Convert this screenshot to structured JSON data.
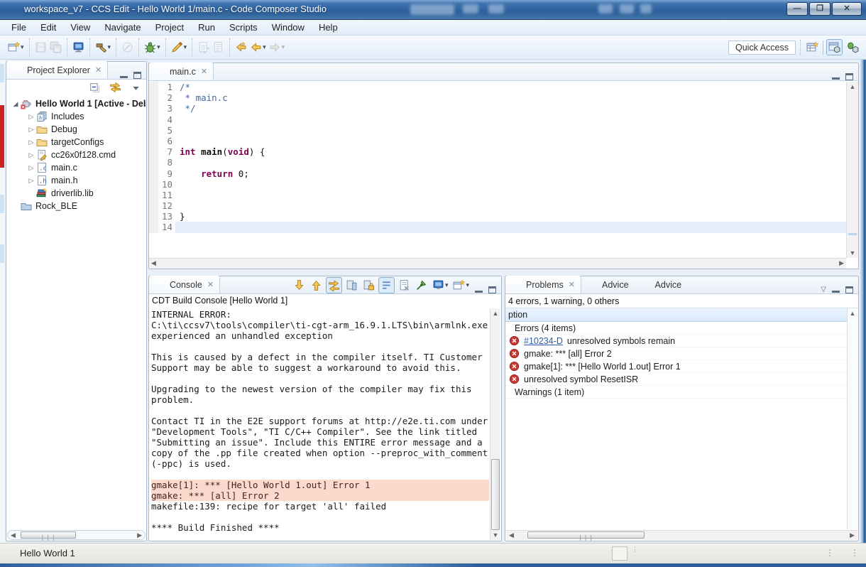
{
  "titlebar": {
    "title": "workspace_v7 - CCS Edit - Hello World 1/main.c - Code Composer Studio"
  },
  "menubar": {
    "items": [
      "File",
      "Edit",
      "View",
      "Navigate",
      "Project",
      "Run",
      "Scripts",
      "Window",
      "Help"
    ]
  },
  "toolbar": {
    "quick_access": "Quick Access",
    "groups": [
      {
        "items": [
          {
            "name": "new-wizard",
            "dropdown": true
          }
        ]
      },
      {
        "items": [
          {
            "name": "save",
            "disabled": true
          },
          {
            "name": "save-all",
            "disabled": true
          }
        ]
      },
      {
        "items": [
          {
            "name": "target-console"
          }
        ]
      },
      {
        "items": [
          {
            "name": "build",
            "dropdown": true
          }
        ]
      },
      {
        "items": [
          {
            "name": "launch",
            "disabled": true
          }
        ]
      },
      {
        "items": [
          {
            "name": "debug",
            "dropdown": true
          }
        ]
      },
      {
        "items": [
          {
            "name": "flash",
            "dropdown": true
          }
        ]
      },
      {
        "items": [
          {
            "name": "sync",
            "disabled": true
          },
          {
            "name": "open-doc",
            "disabled": true
          }
        ]
      },
      {
        "items": [
          {
            "name": "last-edit"
          },
          {
            "name": "back",
            "dropdown": true
          },
          {
            "name": "forward",
            "disabled": true,
            "dropdown": true
          }
        ]
      }
    ],
    "perspectives": [
      {
        "name": "open-perspective",
        "pressed": false
      },
      {
        "name": "ccs-edit-perspective",
        "pressed": true
      },
      {
        "name": "ccs-debug-perspective",
        "pressed": false
      }
    ]
  },
  "project_explorer": {
    "title": "Project Explorer",
    "toolbar": [
      {
        "name": "collapse-all"
      },
      {
        "name": "link-with-editor"
      },
      {
        "name": "view-menu"
      }
    ],
    "tree": [
      {
        "label": "Hello World 1  [Active - Deb",
        "icon": "ccs-project",
        "level": 0,
        "expander": "expanded",
        "bold": true
      },
      {
        "label": "Includes",
        "icon": "includes",
        "level": 1,
        "expander": "collapsed"
      },
      {
        "label": "Debug",
        "icon": "folder",
        "level": 1,
        "expander": "collapsed"
      },
      {
        "label": "targetConfigs",
        "icon": "folder",
        "level": 1,
        "expander": "collapsed"
      },
      {
        "label": "cc26x0f128.cmd",
        "icon": "cmd-file",
        "level": 1,
        "expander": "collapsed"
      },
      {
        "label": "main.c",
        "icon": "c-file",
        "level": 1,
        "expander": "collapsed"
      },
      {
        "label": "main.h",
        "icon": "h-file",
        "level": 1,
        "expander": "collapsed"
      },
      {
        "label": "driverlib.lib",
        "icon": "library",
        "level": 1,
        "expander": null
      },
      {
        "label": "Rock_BLE",
        "icon": "closed-project",
        "level": 0,
        "expander": null
      }
    ]
  },
  "editor": {
    "tab": "main.c",
    "lines": [
      {
        "n": "1",
        "hl": false,
        "parts": [
          {
            "t": "/*",
            "c": "comment"
          }
        ]
      },
      {
        "n": "2",
        "hl": false,
        "parts": [
          {
            "t": " * main.c",
            "c": "comment"
          }
        ]
      },
      {
        "n": "3",
        "hl": false,
        "parts": [
          {
            "t": " */",
            "c": "comment"
          }
        ]
      },
      {
        "n": "4",
        "hl": false,
        "parts": []
      },
      {
        "n": "5",
        "hl": false,
        "parts": []
      },
      {
        "n": "6",
        "hl": false,
        "parts": []
      },
      {
        "n": "7",
        "hl": false,
        "parts": [
          {
            "t": "int",
            "c": "kw"
          },
          {
            "t": " ",
            "c": "plain"
          },
          {
            "t": "main",
            "c": "fn"
          },
          {
            "t": "(",
            "c": "plain"
          },
          {
            "t": "void",
            "c": "kw"
          },
          {
            "t": ") {",
            "c": "plain"
          }
        ]
      },
      {
        "n": "8",
        "hl": false,
        "parts": []
      },
      {
        "n": "9",
        "hl": false,
        "parts": [
          {
            "t": "    ",
            "c": "plain"
          },
          {
            "t": "return",
            "c": "kw"
          },
          {
            "t": " 0;",
            "c": "plain"
          }
        ]
      },
      {
        "n": "10",
        "hl": false,
        "parts": []
      },
      {
        "n": "11",
        "hl": false,
        "parts": []
      },
      {
        "n": "12",
        "hl": false,
        "parts": []
      },
      {
        "n": "13",
        "hl": false,
        "parts": [
          {
            "t": "}",
            "c": "plain"
          }
        ]
      },
      {
        "n": "14",
        "hl": true,
        "parts": []
      }
    ]
  },
  "console": {
    "tab": "Console",
    "subtitle": "CDT Build Console [Hello World 1]",
    "toolbar": [
      {
        "name": "next-annotation"
      },
      {
        "name": "prev-annotation"
      },
      {
        "name": "link-annotations",
        "pressed": true
      },
      {
        "name": "show-console-output"
      },
      {
        "name": "scroll-lock"
      },
      {
        "name": "word-wrap",
        "pressed": true
      },
      {
        "name": "clear-console"
      },
      {
        "name": "pin-console"
      },
      {
        "name": "display-console",
        "dropdown": true
      },
      {
        "name": "open-console",
        "dropdown": true
      }
    ],
    "lines": [
      {
        "text": "INTERNAL ERROR: ",
        "hl": false
      },
      {
        "text": "C:\\ti\\ccsv7\\tools\\compiler\\ti-cgt-arm_16.9.1.LTS\\bin\\armlnk.exe",
        "hl": false
      },
      {
        "text": "experienced an unhandled exception",
        "hl": false
      },
      {
        "text": "",
        "hl": false
      },
      {
        "text": "This is caused by a defect in the compiler itself. TI Customer",
        "hl": false
      },
      {
        "text": "Support may be able to suggest a workaround to avoid this.",
        "hl": false
      },
      {
        "text": "",
        "hl": false
      },
      {
        "text": "Upgrading to the newest version of the compiler may fix this",
        "hl": false
      },
      {
        "text": "problem.",
        "hl": false
      },
      {
        "text": "",
        "hl": false
      },
      {
        "text": "Contact TI in the E2E support forums at http://e2e.ti.com under",
        "hl": false
      },
      {
        "text": "\"Development Tools\", \"TI C/C++ Compiler\". See the link titled",
        "hl": false
      },
      {
        "text": "\"Submitting an issue\". Include this ENTIRE error message and a",
        "hl": false
      },
      {
        "text": "copy of the .pp file created when option --preproc_with_comment",
        "hl": false
      },
      {
        "text": "(-ppc) is used.",
        "hl": false
      },
      {
        "text": "",
        "hl": false
      },
      {
        "text": "gmake[1]: *** [Hello World 1.out] Error 1",
        "hl": true
      },
      {
        "text": "gmake: *** [all] Error 2",
        "hl": true
      },
      {
        "text": "makefile:139: recipe for target 'all' failed",
        "hl": false
      },
      {
        "text": "",
        "hl": false
      },
      {
        "text": "**** Build Finished ****",
        "hl": false
      }
    ]
  },
  "problems": {
    "tabs": [
      {
        "label": "Problems",
        "icon": "problems"
      },
      {
        "label": "Advice",
        "icon": "bulb"
      },
      {
        "label": "Advice",
        "icon": "globe"
      }
    ],
    "summary": "4 errors, 1 warning, 0 others",
    "column_header": "ption",
    "rows": [
      {
        "kind": "group",
        "text": "Errors (4 items)"
      },
      {
        "kind": "error",
        "link": "#10234-D",
        "text": "unresolved symbols remain"
      },
      {
        "kind": "error",
        "text": "gmake: *** [all] Error 2"
      },
      {
        "kind": "error",
        "text": "gmake[1]: *** [Hello World 1.out] Error 1"
      },
      {
        "kind": "error",
        "text": "unresolved symbol ResetISR"
      },
      {
        "kind": "group",
        "text": "Warnings (1 item)"
      }
    ]
  },
  "statusbar": {
    "project": "Hello World 1"
  }
}
